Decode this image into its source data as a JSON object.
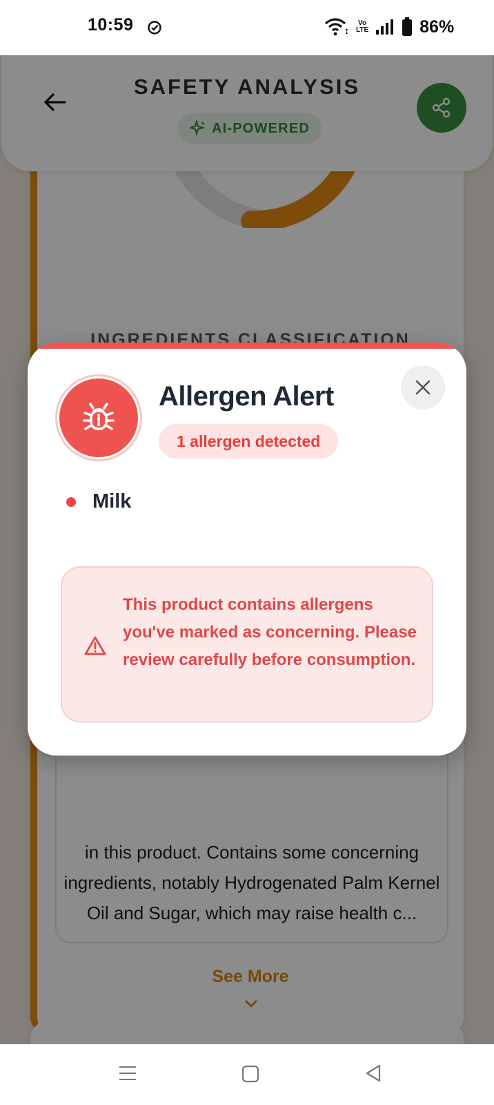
{
  "status_bar": {
    "time": "10:59",
    "network_label_top": "Vo",
    "network_label_bottom": "LTE",
    "battery_percent": "86%",
    "icons": [
      "check-circle-icon",
      "wifi-icon",
      "volte-icon",
      "signal-icon",
      "battery-icon"
    ]
  },
  "header": {
    "title": "SAFETY ANALYSIS",
    "badge": "AI-POWERED",
    "icons": [
      "back-arrow-icon",
      "sparkle-icon",
      "share-icon"
    ]
  },
  "background": {
    "section_title": "INGREDIENTS CLASSIFICATION",
    "summary_text": "in this product. Contains some concerning ingredients, notably Hydrogenated Palm Kernel Oil and Sugar, which may raise health c...",
    "see_more": "See More"
  },
  "modal": {
    "title": "Allergen Alert",
    "count_badge": "1 allergen detected",
    "allergens": [
      "Milk"
    ],
    "warning_text": "This product contains allergens you've marked as concerning. Please review carefully before consumption.",
    "icons": [
      "bug-icon",
      "close-icon",
      "warning-triangle-icon"
    ]
  },
  "colors": {
    "alert_red": "#ef5350",
    "brand_green": "#3a8e3e",
    "accent_orange": "#e38a13"
  }
}
